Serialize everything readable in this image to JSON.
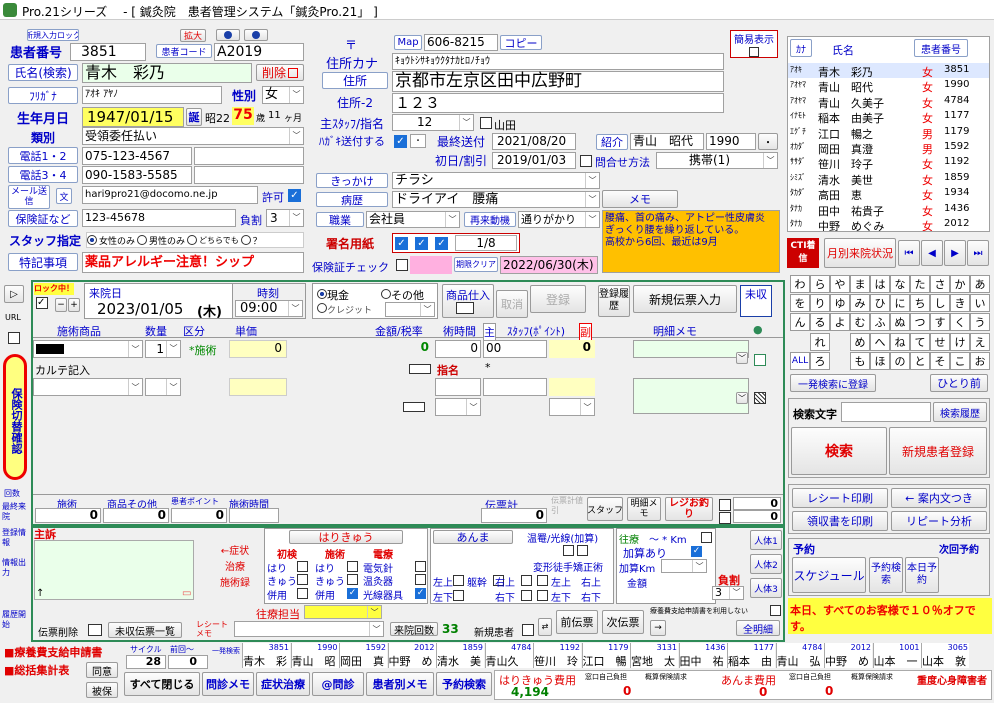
{
  "window": {
    "title": "Pro.21シリーズ　 - [ 鍼灸院　患者管理システム「鍼灸Pro.21」 ]"
  },
  "colors": {
    "label_blue": "#0000c8",
    "red": "#e00000",
    "yellow": "#ffff60",
    "green_frame": "#2e8b57",
    "orange": "#ffc000"
  },
  "patient": {
    "lock_btn": "新規入力ロック",
    "expand_btn": "拡大",
    "number_label": "患者番号",
    "number": "3851",
    "code_label": "患者コード",
    "code": "A2019",
    "name_label": "氏名(検索)",
    "name": "青木　彩乃",
    "delete_btn": "削除",
    "furigana_label": "ﾌﾘｶﾞﾅ",
    "furigana": "ｱｵｷ ｱﾔﾉ",
    "gender_label": "性別",
    "gender": "女",
    "birth_label": "生年月日",
    "birth": "1947/01/15",
    "birth_btn": "誕",
    "era": "昭22",
    "age": "75",
    "age_unit": "歳",
    "months": "11",
    "months_unit": "ヶ月",
    "type_label": "類別",
    "type": "受領委任払い",
    "tel12_label": "電話1・2",
    "tel1": "075-123-4567",
    "tel34_label": "電話3・4",
    "tel3": "090-1583-5585",
    "mail_label": "メール送信",
    "mail_btn2": "文",
    "mail": "hari9pro21@docomo.ne.jp",
    "mail_allow": "許可",
    "insurance_label": "保険証など",
    "insurance": "123-45678",
    "burden_label": "負割",
    "burden": "3",
    "staff_label": "スタッフ指定",
    "staff_opt1": "女性のみ",
    "staff_opt2": "男性のみ",
    "staff_opt3": "どちらでも",
    "staff_opt4": "？",
    "notes_label": "特記事項",
    "notes": "薬品アレルギー注意！シップ"
  },
  "address": {
    "zip_mark": "〒",
    "map_btn": "Map",
    "zip": "606-8215",
    "copy_btn": "コピー",
    "simple_label": "簡易表示",
    "kana_label": "住所カナ",
    "kana": "ｷｮｳﾄｼｻｷｮｳｸﾀﾅｶﾋﾛﾉﾁｮｳ",
    "addr_label": "住所",
    "addr": "京都市左京区田中広野町",
    "addr2_label": "住所-2",
    "addr2": "１２３",
    "staff_label": "主ｽﾀｯﾌ/指名",
    "staff_no": "12",
    "yamada": "山田",
    "hagaki_label": "ﾊｶﾞｷ送付する",
    "hagaki_sub": "・",
    "last_sent_label": "最終送付",
    "last_sent": "2021/08/20",
    "intro_label": "紹介",
    "intro_name": "青山　昭代",
    "intro_no": "1990",
    "intro_dot": "・",
    "first_label": "初日/割引",
    "first": "2019/01/03",
    "contact_label": "問合せ方法",
    "contact": "携帯(1)",
    "trigger_label": "きっかけ",
    "trigger": "チラシ",
    "memo_btn": "メモ",
    "disease_label": "病歴",
    "disease": "ドライアイ　腰痛",
    "job_label": "職業",
    "job": "会社員",
    "revisit_btn": "再来動機",
    "revisit": "通りがかり",
    "memo_text": "腰痛、首の痛み、アトピー性皮膚炎\nぎっくり腰を繰り返している。\n高校から6回、最近は9月",
    "sign_label": "署名用紙",
    "sign_count": "1/8",
    "ins_check_label": "保険証チェック",
    "expire_btn": "期限クリア",
    "expire": "2022/06/30(木)"
  },
  "patient_list": {
    "headers": [
      "ｶﾅ",
      "氏名",
      "患者番号"
    ],
    "rows": [
      [
        "ｱｵｷ",
        "青木　彩乃",
        "女",
        "3851"
      ],
      [
        "ｱｵﾔﾏ",
        "青山　昭代",
        "女",
        "1990"
      ],
      [
        "ｱｵﾔﾏ",
        "青山　久美子",
        "女",
        "4784"
      ],
      [
        "ｲﾅﾓﾄ",
        "稲本　由美子",
        "女",
        "1177"
      ],
      [
        "ｴｸﾞﾁ",
        "江口　暢之",
        "男",
        "1179"
      ],
      [
        "ｵｶﾀﾞ",
        "岡田　真澄",
        "男",
        "1592"
      ],
      [
        "ｻｻﾀﾞ",
        "笹川　玲子",
        "女",
        "1192"
      ],
      [
        "ｼﾐｽﾞ",
        "清水　美世",
        "女",
        "1859"
      ],
      [
        "ﾀｶﾀﾞ",
        "高田　恵",
        "女",
        "1934"
      ],
      [
        "ﾀﾅｶ",
        "田中　祐貴子",
        "女",
        "1436"
      ],
      [
        "ﾀﾅｶ",
        "中野　めぐみ",
        "女",
        "2012"
      ]
    ],
    "cti_label": "CTI着信",
    "monthly_btn": "月別来院状況"
  },
  "kana_grid": [
    "わ",
    "ら",
    "や",
    "ま",
    "は",
    "な",
    "た",
    "さ",
    "か",
    "あ",
    "を",
    "り",
    "ゆ",
    "み",
    "ひ",
    "に",
    "ち",
    "し",
    "き",
    "い",
    "ん",
    "る",
    "よ",
    "む",
    "ふ",
    "ぬ",
    "つ",
    "す",
    "く",
    "う",
    "",
    "れ",
    "",
    "め",
    "へ",
    "ね",
    "て",
    "せ",
    "け",
    "え",
    "ALL",
    "ろ",
    "",
    "も",
    "ほ",
    "の",
    "と",
    "そ",
    "こ",
    "お"
  ],
  "search": {
    "all_btn": "一発検索に登録",
    "prev_btn": "ひとり前",
    "text_label": "検索文字",
    "history_btn": "検索履歴",
    "search_btn": "検索",
    "new_btn": "新規患者登録"
  },
  "right_buttons": {
    "receipt": "レシート印刷",
    "guide": "← 案内文つき",
    "receipt2": "領収書を印刷",
    "repeat": "リピート分析"
  },
  "reserve": {
    "label": "予約",
    "last_label": "次回予約",
    "schedule": "スケジュール",
    "search_btn": "予約検索",
    "today_btn": "本日予約"
  },
  "ticker": "本日、すべてのお客様で１０％オフです。",
  "visit": {
    "lock_label": "ロック中！",
    "date_label": "来院日",
    "date": "2023/01/05",
    "weekday": "(木)",
    "time_label": "時刻",
    "time": "09:00",
    "cash": "現金",
    "other": "その他",
    "credit": "クレジット",
    "product_btn": "商品仕入",
    "cancel_btn": "取消",
    "register_btn": "登録",
    "history_btn": "登録履歴",
    "new_slip_btn": "新規伝票入力",
    "unpaid_btn": "未収",
    "cols": [
      "施術商品",
      "数量",
      "区分",
      "単価",
      "金額/税率",
      "術時間",
      "主",
      "ｽﾀｯﾌ(ﾎﾟｲﾝﾄ)",
      "副",
      "明細メモ"
    ],
    "row1_qty": "1",
    "row1_type": "*施術",
    "row1_price": "0",
    "row1_amount": "0",
    "row1_time": "0",
    "row1_staff": "00",
    "row1_pt": "0",
    "row2_name": "カルテ記入",
    "row2_sign": "指名",
    "row2_staff": "*",
    "tot_labels": [
      "施術",
      "商品その他",
      "患者ポイント",
      "施術時間"
    ],
    "tot_shijutsu": "0",
    "tot_shohin": "0",
    "tot_point": "0",
    "slip_label": "伝票計",
    "slip_total": "0",
    "slip_disc": "伝票計値引",
    "staff_btn": "スタッフ",
    "detail_btn": "明細メモ",
    "reji_btn": "レジお釣り",
    "right_total1": "0",
    "right_total2": "0"
  },
  "left_tools": [
    "URL",
    "保険切替確認",
    "回数",
    "最終来院",
    "登録情報",
    "情報出力",
    "履歴開始"
  ],
  "symptoms": {
    "main_label": "主訴",
    "symptom_btn": "←症状",
    "treat_btn": "治療",
    "record_btn": "施術録",
    "harikyu": "はりきゅう",
    "anma": "あんま",
    "init_label": "初検",
    "procedure_label": "施術",
    "elec_label": "電療",
    "hari": "はり",
    "kyu": "きゅう",
    "hei": "併用",
    "elec1": "電気針",
    "elec2": "温灸器",
    "elec3": "光線器具",
    "onpu": "温罨/光線(加算)",
    "henkei": "変形徒手矯正術",
    "left_up": "左上",
    "left_down": "左下",
    "back": "躯幹",
    "right_up": "右上",
    "right_down": "右下",
    "visit_label": "往療",
    "visit_km": "〜 * Km",
    "add_label": "加算あり",
    "add_km": "加算Km",
    "amount_label": "金額",
    "people1": "人体1",
    "people2": "人体2",
    "people3": "人体3",
    "burden": "負割",
    "burden_val": "3",
    "staff_label": "往療担当"
  },
  "bottom": {
    "slip_del": "伝票削除",
    "unpaid_list": "未収伝票一覧",
    "receipt_memo": "レシートメモ",
    "visit_count_btn": "来院回数",
    "visit_count": "33",
    "new_patient": "新規患者",
    "prev_slip": "前伝票",
    "next_slip": "次伝票",
    "notice": "療養費支給申請書を利用しない",
    "detail_btn": "全明細",
    "app1": "■療養費支給申請書",
    "app2": "■総括集計表",
    "agree": "同意",
    "rejected": "被保",
    "cycle_label": "サイクル",
    "prev_label": "前回〜",
    "cycle": "28",
    "prev": "0",
    "one_search": "一発検索",
    "history_nums": [
      "3851",
      "1990",
      "1592",
      "2012",
      "1859",
      "4784",
      "1192",
      "1179",
      "3131",
      "1436",
      "1177",
      "4784",
      "2012",
      "1001",
      "3065"
    ],
    "history_names": [
      "青木　彩",
      "青山　昭",
      "岡田　真",
      "中野　め",
      "清水　美",
      "青山久",
      "笹川　玲",
      "江口　暢",
      "宮地　太",
      "田中　祐",
      "稲本　由",
      "青山　弘",
      "中野　め",
      "山本　一",
      "山本　敦"
    ],
    "close_all": "すべて閉じる",
    "interview": "問診メモ",
    "symptom": "症状治療",
    "at_interview": "@問診",
    "patient_memo": "患者別メモ",
    "reserve_search": "予約検索",
    "harikyu_fee": "はりきゅう費用",
    "harikyu_val": "4,194",
    "self_pay": "窓口自己負担",
    "self_val": "0",
    "approx_ins": "概算保険請求",
    "anma_fee": "あんま費用",
    "anma_val": "0",
    "self_pay2": "窓口自己負担",
    "self_val2": "0",
    "approx_ins2": "概算保険請求",
    "heavy": "重度心身障害者"
  }
}
